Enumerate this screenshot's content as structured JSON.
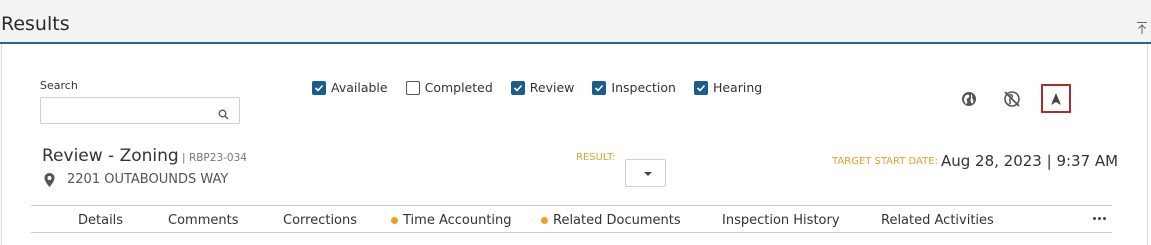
{
  "header": {
    "title": "Results"
  },
  "search": {
    "label": "Search",
    "placeholder": "",
    "value": ""
  },
  "filters": [
    {
      "label": "Available",
      "checked": true
    },
    {
      "label": "Completed",
      "checked": false
    },
    {
      "label": "Review",
      "checked": true
    },
    {
      "label": "Inspection",
      "checked": true
    },
    {
      "label": "Hearing",
      "checked": true
    }
  ],
  "record": {
    "title": "Review - Zoning",
    "separator": " | ",
    "id": "RBP23-034",
    "address": "2201 OUTABOUNDS WAY"
  },
  "result": {
    "label": "RESULT:",
    "value": ""
  },
  "target": {
    "label": "TARGET START DATE:",
    "value": "Aug 28, 2023 | 9:37 AM"
  },
  "tabs": [
    {
      "label": "Details",
      "dot": false
    },
    {
      "label": "Comments",
      "dot": false
    },
    {
      "label": "Corrections",
      "dot": false
    },
    {
      "label": "Time Accounting",
      "dot": true
    },
    {
      "label": "Related Documents",
      "dot": true
    },
    {
      "label": "Inspection History",
      "dot": false
    },
    {
      "label": "Related Activities",
      "dot": false
    }
  ],
  "colors": {
    "accent": "#1b5c8e",
    "highlight_border": "#b22a2a",
    "label_orange": "#e0a22a",
    "dot_orange": "#f0a020"
  },
  "icons": [
    "collapse-icon",
    "search-icon",
    "globe-icon",
    "globe-off-icon",
    "navigation-arrow-icon",
    "map-pin-icon",
    "more-icon"
  ]
}
